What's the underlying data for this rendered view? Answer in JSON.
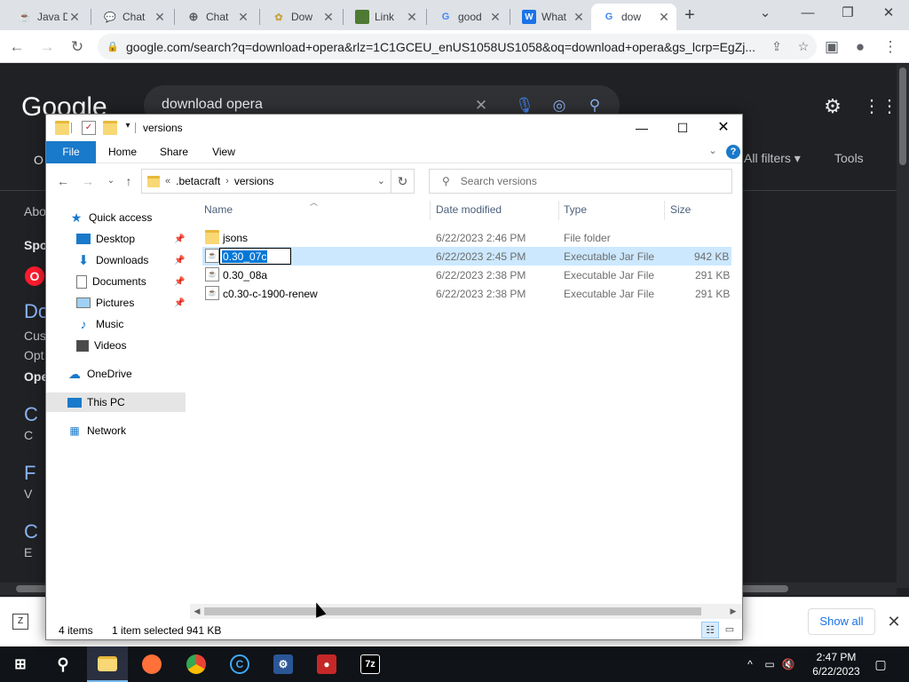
{
  "browser": {
    "tabs": [
      {
        "title": "Java D",
        "icon": "java-icon",
        "color": "#e76f00"
      },
      {
        "title": "Chat",
        "icon": "chat-icon",
        "color": "#60a5fa"
      },
      {
        "title": "Chat",
        "icon": "globe-icon",
        "color": "#5f6368"
      },
      {
        "title": "Dow",
        "icon": "flower-icon",
        "color": "#c8a640"
      },
      {
        "title": "Link",
        "icon": "grass-block-icon",
        "color": "#4e7a33"
      },
      {
        "title": "good",
        "icon": "google-icon",
        "color": "#4285f4"
      },
      {
        "title": "What",
        "icon": "w-icon",
        "color": "#1a73e8"
      },
      {
        "title": "dow",
        "icon": "google-icon",
        "color": "#4285f4"
      }
    ],
    "url": "google.com/search?q=download+opera&rlz=1C1GCEU_enUS1058US1058&oq=download+opera&gs_lcrp=EgZj..."
  },
  "google": {
    "logo": "Google",
    "query": "download opera",
    "filters": [
      "All filters",
      "Tools"
    ],
    "left_fragments": [
      "Abo",
      "Spo",
      "Do",
      "Cus",
      "Opt",
      "Ope",
      "C",
      "C",
      "F",
      "V",
      "C",
      "E"
    ],
    "left_first": "O"
  },
  "explorer": {
    "title": "versions",
    "ribbon": {
      "file": "File",
      "home": "Home",
      "share": "Share",
      "view": "View"
    },
    "address": {
      "prefix": "«",
      "parent": ".betacraft",
      "current": "versions"
    },
    "search_placeholder": "Search versions",
    "nav": {
      "quick_access": "Quick access",
      "desktop": "Desktop",
      "downloads": "Downloads",
      "documents": "Documents",
      "pictures": "Pictures",
      "music": "Music",
      "videos": "Videos",
      "onedrive": "OneDrive",
      "this_pc": "This PC",
      "network": "Network"
    },
    "columns": {
      "name": "Name",
      "date": "Date modified",
      "type": "Type",
      "size": "Size"
    },
    "files": [
      {
        "name": "jsons",
        "date": "6/22/2023 2:46 PM",
        "type": "File folder",
        "size": ""
      },
      {
        "name": "0.30_07c",
        "date": "6/22/2023 2:45 PM",
        "type": "Executable Jar File",
        "size": "942 KB"
      },
      {
        "name": "0.30_08a",
        "date": "6/22/2023 2:38 PM",
        "type": "Executable Jar File",
        "size": "291 KB"
      },
      {
        "name": "c0.30-c-1900-renew",
        "date": "6/22/2023 2:38 PM",
        "type": "Executable Jar File",
        "size": "291 KB"
      }
    ],
    "status": {
      "items": "4 items",
      "selected": "1 item selected",
      "selected_size": "941 KB"
    }
  },
  "downloads_bar": {
    "show_all": "Show all"
  },
  "taskbar": {
    "time": "2:47 PM",
    "date": "6/22/2023"
  },
  "colors": {
    "accent": "#1979ca",
    "selection": "#cce8ff",
    "google_dark": "#202124"
  }
}
